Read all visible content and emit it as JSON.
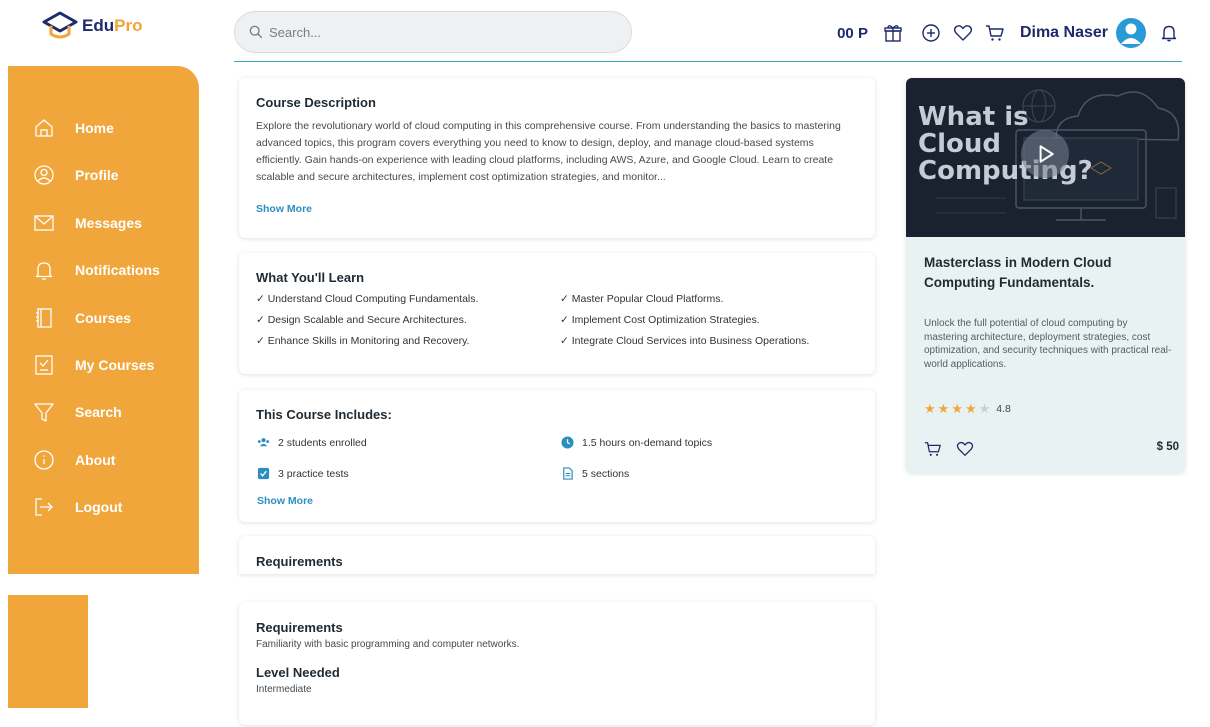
{
  "brand": {
    "edu": "Edu",
    "pro": "Pro"
  },
  "search": {
    "placeholder": "Search..."
  },
  "header": {
    "points": "00 P",
    "user_name": "Dima Naser"
  },
  "sidebar": {
    "items": [
      {
        "label": "Home",
        "icon": "home-icon"
      },
      {
        "label": "Profile",
        "icon": "user-circle-icon"
      },
      {
        "label": "Messages",
        "icon": "envelope-icon"
      },
      {
        "label": "Notifications",
        "icon": "bell-icon"
      },
      {
        "label": "Courses",
        "icon": "book-icon"
      },
      {
        "label": "My Courses",
        "icon": "checklist-icon"
      },
      {
        "label": "Search",
        "icon": "filter-icon"
      },
      {
        "label": "About",
        "icon": "info-icon"
      },
      {
        "label": "Logout",
        "icon": "logout-icon"
      }
    ]
  },
  "description": {
    "title": "Course Description",
    "text": "Explore the revolutionary world of cloud computing in this comprehensive course. From understanding the basics to mastering advanced topics, this program covers everything you need to know to design, deploy, and manage cloud-based systems efficiently. Gain hands-on experience with leading cloud platforms, including AWS, Azure, and Google Cloud. Learn to create scalable and secure architectures, implement cost optimization strategies, and monitor...",
    "show_more": "Show More"
  },
  "learn": {
    "title": "What You'll Learn",
    "items": [
      "✓ Understand Cloud Computing Fundamentals.",
      "✓ Master Popular Cloud Platforms.",
      "✓ Design Scalable and Secure Architectures.",
      "✓ Implement Cost Optimization Strategies.",
      "✓ Enhance Skills in Monitoring and Recovery.",
      "✓ Integrate Cloud Services into Business Operations."
    ]
  },
  "includes": {
    "title": "This Course Includes:",
    "students": "2 students enrolled",
    "hours": "1.5 hours on-demand topics",
    "tests": "3 practice tests",
    "sections": "5 sections",
    "show_more": "Show More"
  },
  "requirements_header": {
    "title": "Requirements"
  },
  "requirements": {
    "title": "Requirements",
    "text": "Familiarity with basic programming and computer networks.",
    "level_title": "Level Needed",
    "level": "Intermediate"
  },
  "course": {
    "video_title": "What is Cloud Computing?",
    "title": "Masterclass in Modern Cloud Computing Fundamentals.",
    "description": "Unlock the full potential of cloud computing by mastering architecture, deployment strategies, cost optimization, and security techniques with practical real-world applications.",
    "rating": "4.8",
    "rating_value": 4.8,
    "price": "$ 50"
  },
  "colors": {
    "accent": "#f0a63a",
    "brand_navy": "#1e2a6b",
    "link": "#2a8fbf"
  }
}
